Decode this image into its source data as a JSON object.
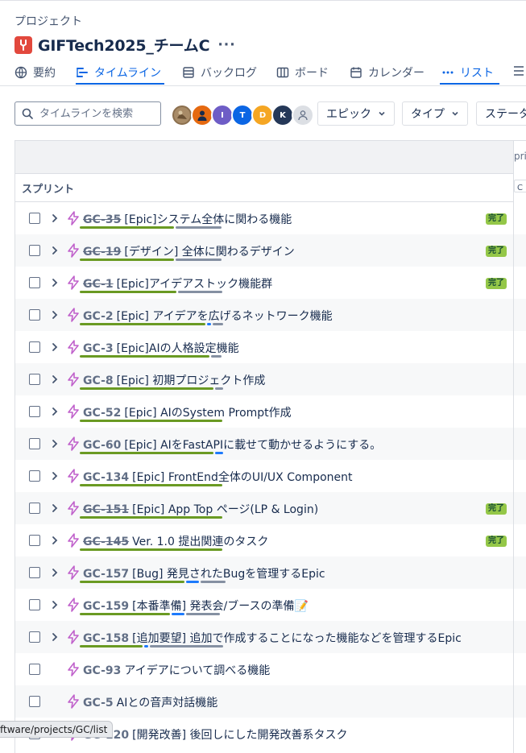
{
  "breadcrumb": "プロジェクト",
  "project": {
    "title": "GIFTech2025_チームC",
    "more": "···"
  },
  "tabs": [
    {
      "label": "要約",
      "icon": "globe-icon"
    },
    {
      "label": "タイムライン",
      "icon": "timeline-icon",
      "active": true
    },
    {
      "label": "バックログ",
      "icon": "backlog-icon"
    },
    {
      "label": "ボード",
      "icon": "board-icon"
    },
    {
      "label": "カレンダー",
      "icon": "calendar-icon"
    },
    {
      "label": "リスト",
      "icon": "more-dots-icon"
    }
  ],
  "search": {
    "placeholder": "タイムラインを検索"
  },
  "avatars": [
    {
      "initial": "",
      "color": "#8b6f4e",
      "kind": "photo"
    },
    {
      "initial": "",
      "color": "#e56910",
      "kind": "person"
    },
    {
      "initial": "I",
      "color": "#6e5dc6"
    },
    {
      "initial": "T",
      "color": "#0c66e4"
    },
    {
      "initial": "D",
      "color": "#f5a623"
    },
    {
      "initial": "K",
      "color": "#253858"
    },
    {
      "initial": "",
      "color": "#dcdfe4",
      "kind": "unassigned"
    }
  ],
  "filters": {
    "epic": "エピック",
    "type": "タイプ",
    "status": "ステータ"
  },
  "grid": {
    "sprint_label": "スプリント",
    "month": "pril",
    "month_chip": "C ス"
  },
  "status_done": "完了",
  "rows": [
    {
      "key": "GC-35",
      "title": "[Epic]システム全体に関わる機能",
      "done": true,
      "expand": true,
      "progress": [
        0.45,
        0,
        0.22
      ]
    },
    {
      "key": "GC-19",
      "title": "[デザイン] 全体に関わるデザイン",
      "done": true,
      "expand": true,
      "progress": [
        0.45,
        0,
        0.22
      ]
    },
    {
      "key": "GC-1",
      "title": "[Epic]アイデアストック機能群",
      "done": true,
      "expand": true,
      "progress": [
        0.46,
        0,
        0.21
      ]
    },
    {
      "key": "GC-2",
      "title": "[Epic] アイデアを広げるネットワーク機能",
      "done": false,
      "expand": true,
      "progress": [
        0.6,
        0.02,
        0.05
      ]
    },
    {
      "key": "GC-3",
      "title": "[Epic]AIの人格設定機能",
      "done": false,
      "expand": true,
      "progress": [
        0.62,
        0,
        0.05
      ]
    },
    {
      "key": "GC-8",
      "title": "[Epic] 初期プロジェクト作成",
      "done": false,
      "expand": true,
      "progress": [
        0.64,
        0,
        0.04
      ]
    },
    {
      "key": "GC-52",
      "title": "[Epic] AIのSystem Prompt作成",
      "done": false,
      "expand": true,
      "progress": [
        0.68,
        0,
        0
      ]
    },
    {
      "key": "GC-60",
      "title": "[Epic] AIをFastAPIに載せて動かせるようにする。",
      "done": false,
      "expand": true,
      "progress": [
        0.64,
        0.04,
        0
      ]
    },
    {
      "key": "GC-134",
      "title": "[Epic] FrontEnd全体のUI/UX Component",
      "done": false,
      "expand": true,
      "progress": [
        0.68,
        0,
        0
      ]
    },
    {
      "key": "GC-151",
      "title": "[Epic] App Top ページ(LP & Login)",
      "done": true,
      "expand": true,
      "progress": [
        0.68,
        0,
        0
      ]
    },
    {
      "key": "GC-145",
      "title": "Ver. 1.0 提出関連のタスク",
      "done": true,
      "expand": true,
      "progress": [
        0.68,
        0,
        0
      ]
    },
    {
      "key": "GC-157",
      "title": "[Bug] 発見されたBugを管理するEpic",
      "done": false,
      "expand": true,
      "progress": [
        0.5,
        0.06,
        0.12
      ]
    },
    {
      "key": "GC-159",
      "title": "[本番準備] 発表会/ブースの準備📝",
      "done": false,
      "expand": true,
      "progress": [
        0.43,
        0.06,
        0.16
      ]
    },
    {
      "key": "GC-158",
      "title": "[追加要望] 追加で作成することになった機能などを管理するEpic",
      "done": false,
      "expand": true,
      "progress": [
        0.3,
        0.02,
        0.35
      ]
    },
    {
      "key": "GC-93",
      "title": "アイデアについて調べる機能",
      "done": false,
      "expand": false,
      "progress": [
        0,
        0,
        0
      ]
    },
    {
      "key": "GC-5",
      "title": "AIとの音声対話機能",
      "done": false,
      "expand": false,
      "progress": [
        0,
        0,
        0
      ]
    },
    {
      "key": "GC-120",
      "title": "[開発改善] 後回しにした開発改善系タスク",
      "done": false,
      "expand": false,
      "progress": [
        0,
        0,
        0
      ]
    }
  ],
  "status_url": "ftware/projects/GC/list"
}
